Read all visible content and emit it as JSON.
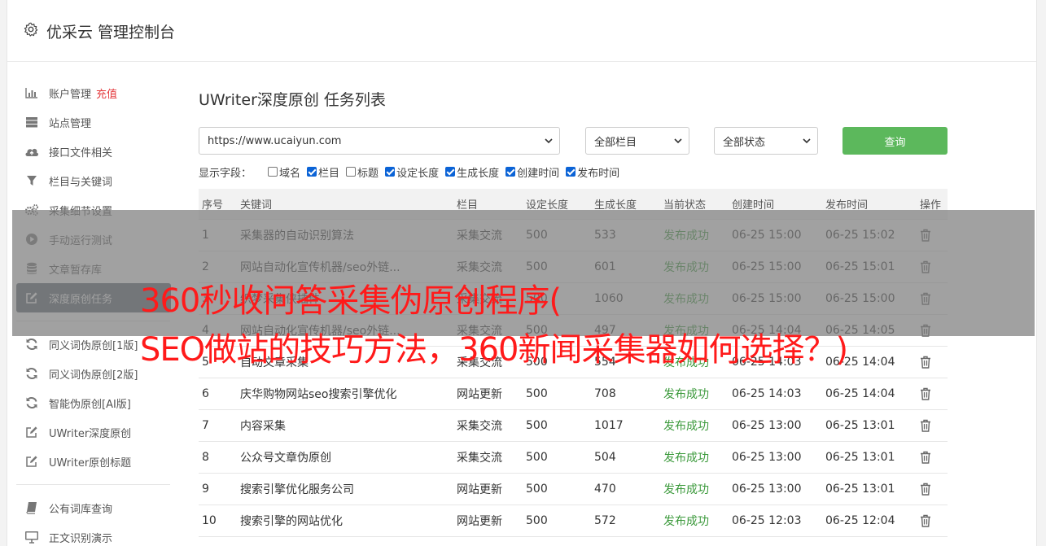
{
  "header": {
    "title": "优采云 管理控制台"
  },
  "sidebar": {
    "items": [
      {
        "icon": "bar-chart-icon",
        "label": "账户管理",
        "tag": "充值"
      },
      {
        "icon": "server-icon",
        "label": "站点管理"
      },
      {
        "icon": "cloud-upload-icon",
        "label": "接口文件相关"
      },
      {
        "icon": "filter-icon",
        "label": "栏目与关键词"
      },
      {
        "icon": "cogs-icon",
        "label": "采集细节设置"
      },
      {
        "icon": "play-circle-icon",
        "label": "手动运行测试"
      },
      {
        "icon": "database-icon",
        "label": "文章暂存库"
      },
      {
        "icon": "edit-icon",
        "label": "深度原创任务"
      }
    ],
    "items2": [
      {
        "icon": "refresh-icon",
        "label": "同义词伪原创[1版]"
      },
      {
        "icon": "refresh-icon",
        "label": "同义词伪原创[2版]"
      },
      {
        "icon": "refresh-icon",
        "label": "智能伪原创[AI版]"
      },
      {
        "icon": "edit-icon",
        "label": "UWriter深度原创"
      },
      {
        "icon": "edit-icon",
        "label": "UWriter原创标题"
      }
    ],
    "items3": [
      {
        "icon": "book-icon",
        "label": "公有词库查询"
      },
      {
        "icon": "monitor-icon",
        "label": "正文识别演示"
      }
    ]
  },
  "main": {
    "title": "UWriter深度原创 任务列表",
    "site_select": "https://www.ucaiyun.com",
    "column_select": "全部栏目",
    "status_select": "全部状态",
    "query_label": "查询",
    "fields_label": "显示字段：",
    "fields": [
      {
        "label": "域名",
        "checked": false
      },
      {
        "label": "栏目",
        "checked": true
      },
      {
        "label": "标题",
        "checked": false
      },
      {
        "label": "设定长度",
        "checked": true
      },
      {
        "label": "生成长度",
        "checked": true
      },
      {
        "label": "创建时间",
        "checked": true
      },
      {
        "label": "发布时间",
        "checked": true
      }
    ]
  },
  "table": {
    "headers": [
      "序号",
      "关键词",
      "栏目",
      "设定长度",
      "生成长度",
      "当前状态",
      "创建时间",
      "发布时间",
      "操作"
    ],
    "rows": [
      [
        "1",
        "采集器的自动识别算法",
        "采集交流",
        "500",
        "533",
        "发布成功",
        "06-25 15:00",
        "06-25 15:02"
      ],
      [
        "2",
        "网站自动化宣传机器/seo外链...",
        "采集交流",
        "500",
        "601",
        "发布成功",
        "06-25 15:00",
        "06-25 15:01"
      ],
      [
        "3",
        "织梦采集侠插件",
        "采集交流",
        "500",
        "1060",
        "发布成功",
        "06-25 15:00",
        "06-25 15:00"
      ],
      [
        "4",
        "网站自动化宣传机器/seo外链...",
        "采集交流",
        "500",
        "497",
        "发布成功",
        "06-25 14:04",
        "06-25 14:05"
      ],
      [
        "5",
        "自动文章采集",
        "采集交流",
        "500",
        "554",
        "发布成功",
        "06-25 14:03",
        "06-25 14:04"
      ],
      [
        "6",
        "庆华购物网站seo搜索引擎优化",
        "网站更新",
        "500",
        "708",
        "发布成功",
        "06-25 14:03",
        "06-25 14:04"
      ],
      [
        "7",
        "内容采集",
        "采集交流",
        "500",
        "1017",
        "发布成功",
        "06-25 13:00",
        "06-25 13:01"
      ],
      [
        "8",
        "公众号文章伪原创",
        "采集交流",
        "500",
        "504",
        "发布成功",
        "06-25 13:00",
        "06-25 13:01"
      ],
      [
        "9",
        "搜索引擎优化服务公司",
        "网站更新",
        "500",
        "470",
        "发布成功",
        "06-25 13:00",
        "06-25 13:01"
      ],
      [
        "10",
        "搜索引擎的网站优化",
        "网站更新",
        "500",
        "572",
        "发布成功",
        "06-25 12:03",
        "06-25 12:04"
      ]
    ]
  },
  "overlay": {
    "line1": "360秒收问答采集伪原创程序(",
    "line2": "SEO做站的技巧方法，360新闻采集器如何选择？)"
  },
  "colors": {
    "accent": "#5cb85c",
    "active_nav": "#5b6570",
    "status_ok": "#3c9a3c",
    "overlay_text": "#ff1a1a",
    "tag": "#e4393c"
  }
}
